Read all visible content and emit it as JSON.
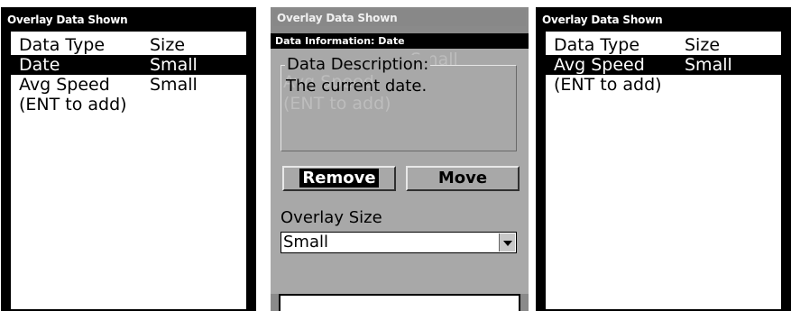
{
  "screens": [
    {
      "title": "Overlay Data Shown",
      "header": {
        "col1": "Data Type",
        "col2": "Size"
      },
      "rows": [
        {
          "type": "Date",
          "size": "Small",
          "selected": true
        },
        {
          "type": "Avg Speed",
          "size": "Small",
          "selected": false
        },
        {
          "type": "(ENT to add)",
          "size": "",
          "selected": false
        }
      ]
    },
    {
      "title": "Overlay Data Shown",
      "dialog": {
        "title": "Data Information: Date",
        "description_label": "Data Description:",
        "description_text": "The current date.",
        "remove_label": "Remove",
        "move_label": "Move",
        "overlay_size_label": "Overlay Size",
        "overlay_size_value": "Small",
        "ghost_type": "Avg Speed",
        "ghost_size": "Small",
        "ghost_add": "(ENT to add)"
      }
    },
    {
      "title": "Overlay Data Shown",
      "header": {
        "col1": "Data Type",
        "col2": "Size"
      },
      "rows": [
        {
          "type": "Avg Speed",
          "size": "Small",
          "selected": true
        },
        {
          "type": "(ENT to add)",
          "size": "",
          "selected": false
        }
      ]
    }
  ]
}
